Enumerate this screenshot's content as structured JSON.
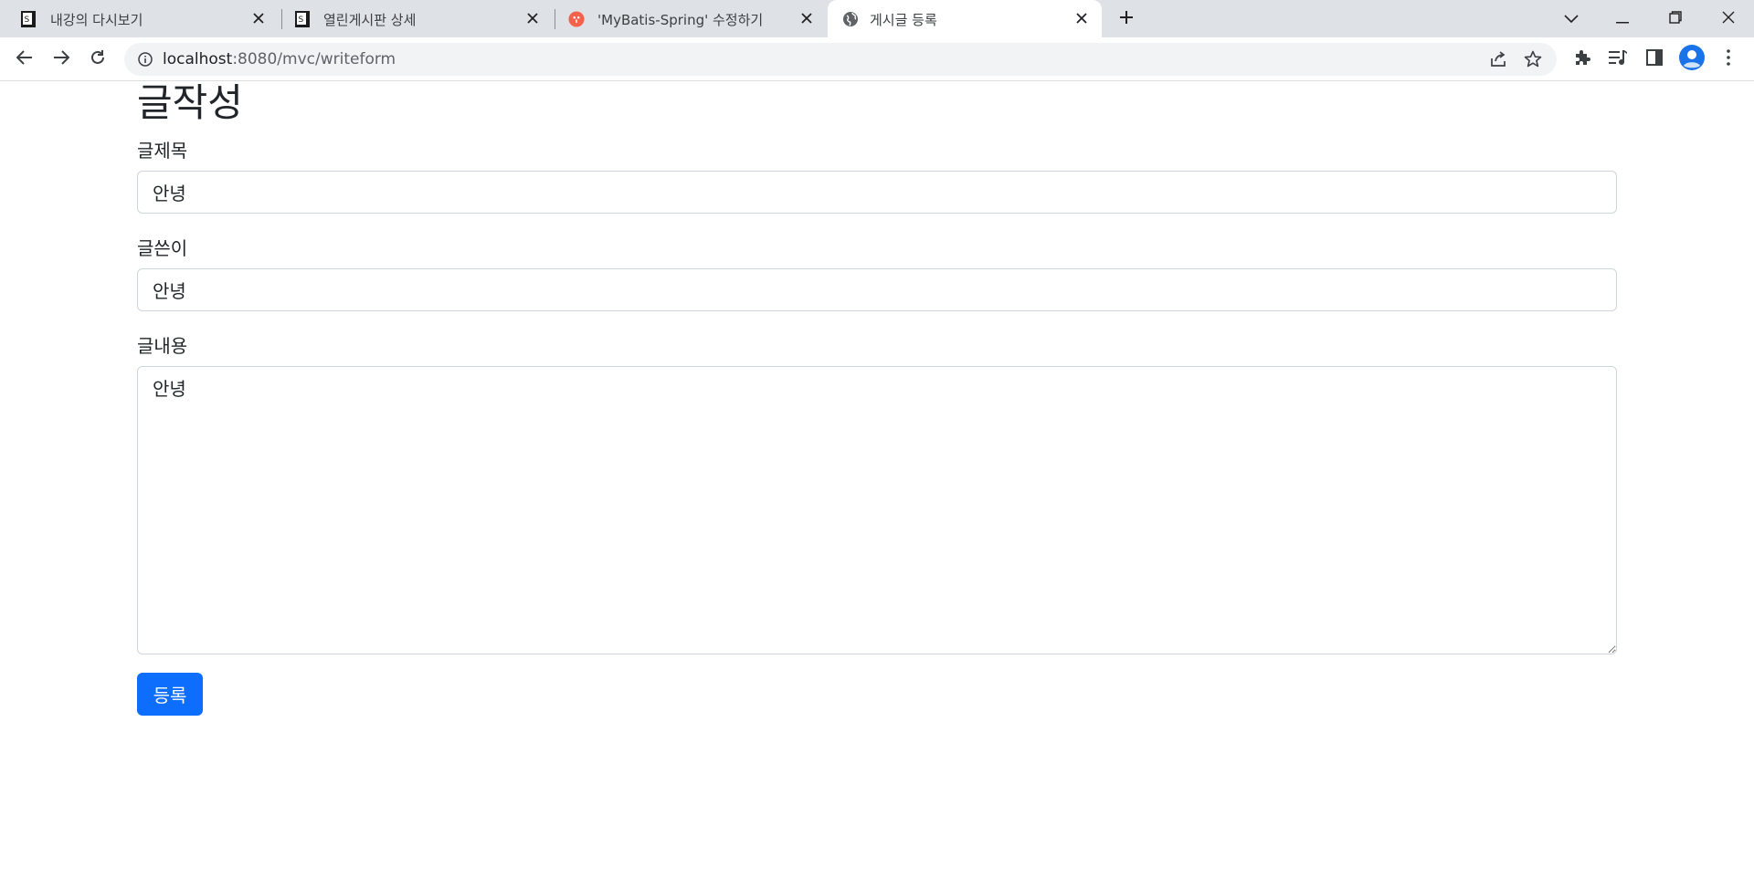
{
  "browser": {
    "tabs": [
      {
        "title": "내강의 다시보기",
        "favicon": "document-s-icon"
      },
      {
        "title": "열린게시판 상세",
        "favicon": "document-s-icon"
      },
      {
        "title": "'MyBatis-Spring' 수정하기",
        "favicon": "red-circle-icon"
      },
      {
        "title": "게시글 등록",
        "favicon": "globe-icon"
      }
    ],
    "active_tab_index": 3,
    "url_host": "localhost",
    "url_path": ":8080/mvc/writeform"
  },
  "page": {
    "title": "글작성",
    "fields": {
      "subject": {
        "label": "글제목",
        "value": "안녕"
      },
      "writer": {
        "label": "글쓴이",
        "value": "안녕"
      },
      "content": {
        "label": "글내용",
        "value": "안녕"
      }
    },
    "submit_label": "등록"
  },
  "colors": {
    "primary": "#0d6efd",
    "tabstrip": "#dee1e6",
    "omnibox": "#f1f3f4",
    "avatar": "#1a73e8"
  }
}
